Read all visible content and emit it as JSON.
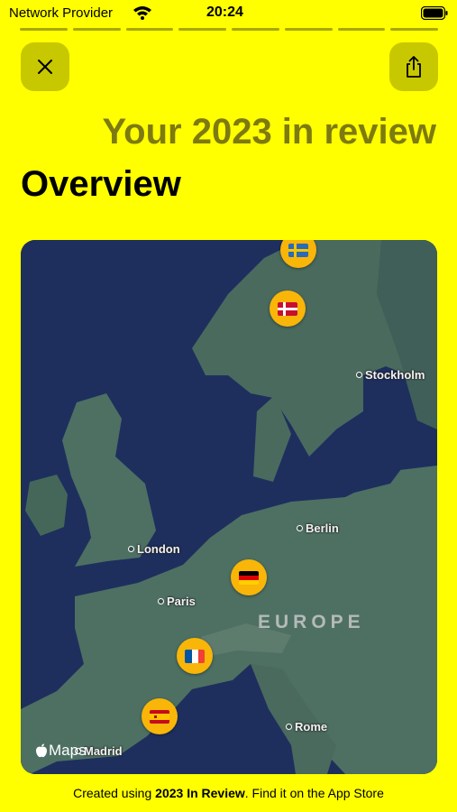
{
  "status_bar": {
    "carrier": "Network Provider",
    "time": "20:24"
  },
  "story_progress": {
    "segments": 8
  },
  "toolbar": {
    "close_icon": "close-icon",
    "share_icon": "share-icon"
  },
  "header": {
    "title": "Your 2023 in review",
    "section": "Overview"
  },
  "map": {
    "cities": [
      "Stockholm",
      "Berlin",
      "London",
      "Paris",
      "Rome",
      "Madrid"
    ],
    "region": "EUROPE",
    "attribution": "Maps",
    "visited_flags": [
      "Sweden",
      "Denmark",
      "Germany",
      "France",
      "Spain"
    ]
  },
  "footer": {
    "prefix": "Created using ",
    "app_name": "2023 In Review",
    "suffix": ". Find it on the App Store"
  },
  "colors": {
    "background": "#ffff00",
    "headline": "#7d7a10",
    "pin": "#f9b608"
  }
}
